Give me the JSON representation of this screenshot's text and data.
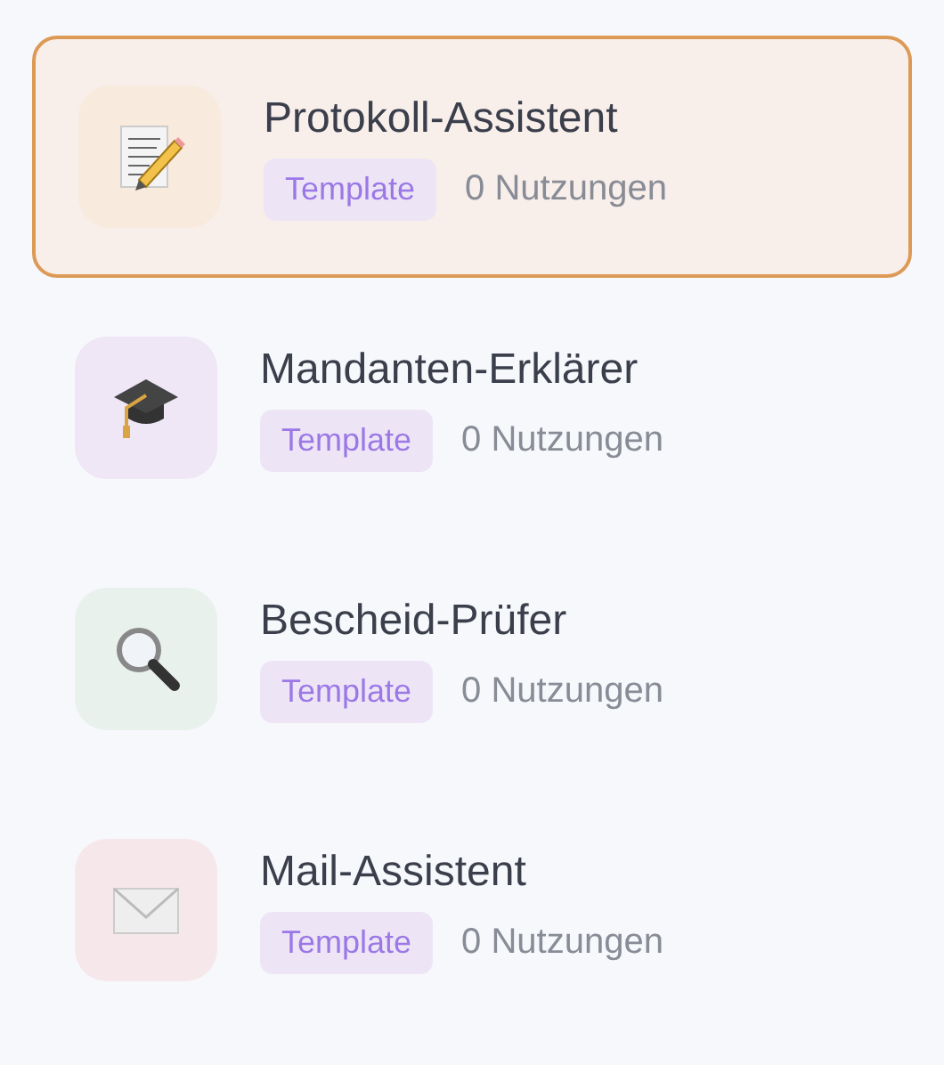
{
  "assistants": [
    {
      "title": "Protokoll-Assistent",
      "badge": "Template",
      "usage": "0 Nutzungen",
      "selected": true,
      "kind": "memo",
      "color": "#f8eadd"
    },
    {
      "title": "Mandanten-Erklärer",
      "badge": "Template",
      "usage": "0 Nutzungen",
      "selected": false,
      "kind": "cap",
      "color": "#efe6f6"
    },
    {
      "title": "Bescheid-Prüfer",
      "badge": "Template",
      "usage": "0 Nutzungen",
      "selected": false,
      "kind": "magnifier",
      "color": "#e8f1ec"
    },
    {
      "title": "Mail-Assistent",
      "badge": "Template",
      "usage": "0 Nutzungen",
      "selected": false,
      "kind": "envelope",
      "color": "#f6e8ea"
    }
  ]
}
